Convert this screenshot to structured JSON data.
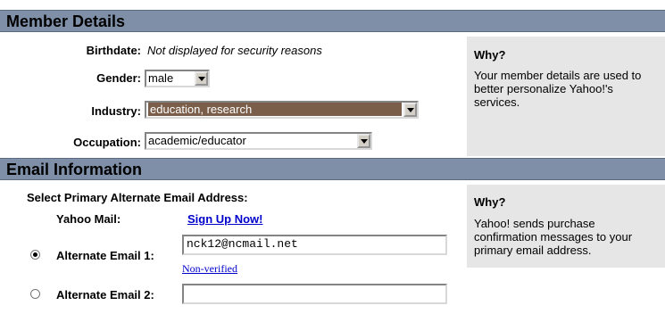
{
  "member_details": {
    "header": "Member Details",
    "birthdate_label": "Birthdate:",
    "birthdate_value": "Not displayed for security reasons",
    "gender_label": "Gender:",
    "gender_value": "male",
    "industry_label": "Industry:",
    "industry_value": "education, research",
    "occupation_label": "Occupation:",
    "occupation_value": "academic/educator",
    "why_title": "Why?",
    "why_text": "Your member details are used to better personalize Yahoo!'s services."
  },
  "email_info": {
    "header": "Email Information",
    "select_label": "Select Primary Alternate Email Address:",
    "yahoo_mail_label": "Yahoo Mail:",
    "sign_up_link": "Sign Up Now!",
    "alt1_label": "Alternate Email 1:",
    "alt1_value": "nck12@ncmail.net",
    "alt1_status": "Non-verified",
    "alt2_label": "Alternate Email 2:",
    "alt2_value": "",
    "why_title": "Why?",
    "why_text": "Yahoo! sends purchase confirmation messages to your primary email address."
  }
}
